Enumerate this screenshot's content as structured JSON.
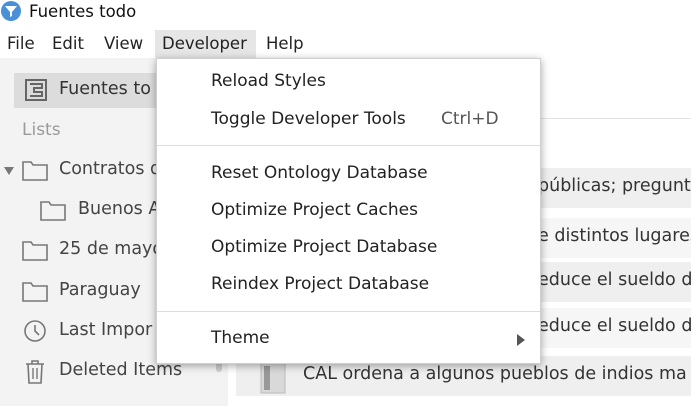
{
  "window": {
    "title": "Fuentes todo",
    "app_icon": "funnel-icon",
    "accent_color": "#4a90d9"
  },
  "menubar": {
    "items": [
      "File",
      "Edit",
      "View",
      "Developer",
      "Help"
    ],
    "active": "Developer"
  },
  "sidebar": {
    "selected_item": {
      "label": "Fuentes to",
      "icon": "project-icon"
    },
    "section_label": "Lists",
    "items": [
      {
        "label": "Contratos d",
        "icon": "folder-icon",
        "expanded": true
      },
      {
        "label": "Buenos A",
        "icon": "folder-icon"
      },
      {
        "label": "25 de mayo",
        "icon": "folder-icon"
      },
      {
        "label": "Paraguay",
        "icon": "folder-icon"
      },
      {
        "label": "Last Impor",
        "icon": "clock-icon"
      },
      {
        "label": "Deleted Items",
        "icon": "trash-icon"
      }
    ]
  },
  "content": {
    "rows": [
      {
        "text": "públicas; pregunt"
      },
      {
        "text": "e distintos lugares"
      },
      {
        "text": "educe el sueldo d"
      },
      {
        "text": "educe el sueldo d"
      },
      {
        "text": "CAL ordena a algunos pueblos de indios ma"
      }
    ]
  },
  "developer_menu": {
    "items": [
      {
        "label": "Reload Styles",
        "shortcut": ""
      },
      {
        "label": "Toggle Developer Tools",
        "shortcut": "Ctrl+D"
      },
      {
        "label": "Reset Ontology Database",
        "shortcut": ""
      },
      {
        "label": "Optimize Project Caches",
        "shortcut": ""
      },
      {
        "label": "Optimize Project Database",
        "shortcut": ""
      },
      {
        "label": "Reindex Project Database",
        "shortcut": ""
      },
      {
        "label": "Theme",
        "shortcut": "",
        "submenu": true
      }
    ]
  }
}
